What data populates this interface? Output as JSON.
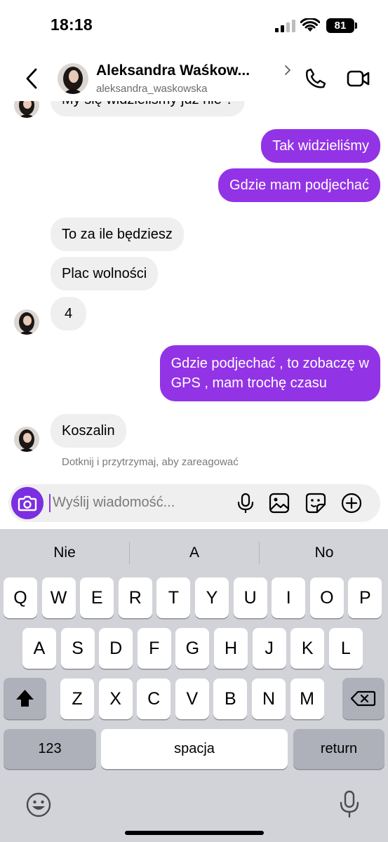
{
  "status_bar": {
    "time": "18:18",
    "battery": "81"
  },
  "header": {
    "name": "Aleksandra Waśkow...",
    "username": "aleksandra_waskowska"
  },
  "messages": [
    {
      "from": "them",
      "text": "My się widzieliśmy już nie ?"
    },
    {
      "from": "me",
      "text": "Tak widzieliśmy"
    },
    {
      "from": "me",
      "text": "Gdzie mam podjechać"
    },
    {
      "from": "them",
      "text": "To za ile będziesz"
    },
    {
      "from": "them",
      "text": "Plac wolności"
    },
    {
      "from": "them",
      "text": "4"
    },
    {
      "from": "me",
      "text_lines": [
        "Gdzie podjechać , to zobaczę w",
        "GPS , mam trochę czasu"
      ]
    },
    {
      "from": "them",
      "text": "Koszalin"
    }
  ],
  "reaction_hint": "Dotknij i przytrzymaj, aby zareagować",
  "composer": {
    "placeholder": "Wyślij wiadomość..."
  },
  "keyboard": {
    "suggestions": [
      "Nie",
      "A",
      "No"
    ],
    "row1": [
      "Q",
      "W",
      "E",
      "R",
      "T",
      "Y",
      "U",
      "I",
      "O",
      "P"
    ],
    "row2": [
      "A",
      "S",
      "D",
      "F",
      "G",
      "H",
      "J",
      "K",
      "L"
    ],
    "row3": [
      "Z",
      "X",
      "C",
      "V",
      "B",
      "N",
      "M"
    ],
    "numbers_label": "123",
    "space_label": "spacja",
    "return_label": "return"
  },
  "colors": {
    "outgoing_bubble": "#9333e6",
    "incoming_bubble": "#efefef",
    "camera_button": "#7b2fe0",
    "keyboard_bg": "#d1d3d9"
  }
}
